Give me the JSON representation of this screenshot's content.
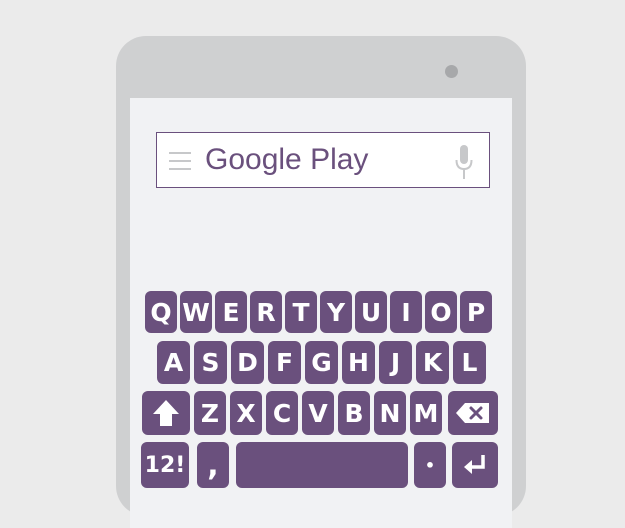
{
  "search": {
    "text": "Google Play",
    "icons": [
      "menu-icon",
      "microphone-icon"
    ]
  },
  "keyboard": {
    "row1": [
      "Q",
      "W",
      "E",
      "R",
      "T",
      "Y",
      "U",
      "I",
      "O",
      "P"
    ],
    "row2": [
      "A",
      "S",
      "D",
      "F",
      "G",
      "H",
      "J",
      "K",
      "L"
    ],
    "row3": [
      "Z",
      "X",
      "C",
      "V",
      "B",
      "N",
      "M"
    ],
    "numbers_label": "12!",
    "comma_label": ",",
    "period_label": "•",
    "icons": [
      "shift-icon",
      "backspace-icon",
      "enter-icon"
    ]
  },
  "colors": {
    "accent": "#6a507d",
    "phone_frame": "#cfd0d1",
    "screen": "#f1f2f4",
    "background": "#ebebeb"
  }
}
